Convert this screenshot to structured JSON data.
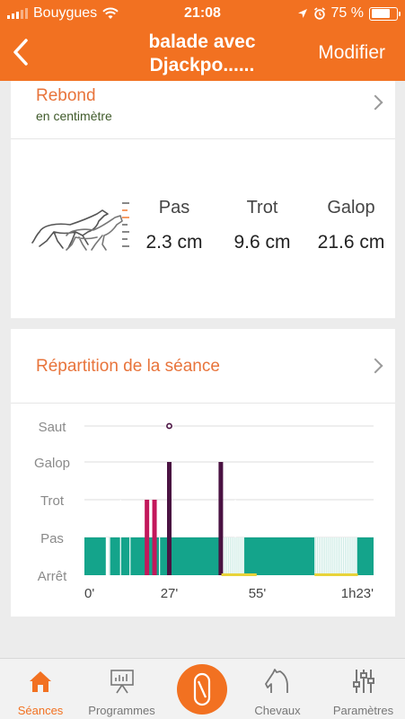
{
  "status": {
    "carrier": "Bouygues",
    "time": "21:08",
    "battery": "75 %",
    "battery_level": 0.75
  },
  "header": {
    "title_line1": "balade avec",
    "title_line2": "Djackpo......",
    "right_label": "Modifier"
  },
  "rebond": {
    "title": "Rebond",
    "subtitle": "en centimètre",
    "columns": [
      {
        "label": "Pas",
        "value": "2.3 cm"
      },
      {
        "label": "Trot",
        "value": "9.6 cm"
      },
      {
        "label": "Galop",
        "value": "21.6 cm"
      }
    ]
  },
  "repartition": {
    "title": "Répartition de la séance"
  },
  "chart_data": {
    "type": "bar",
    "categories": [
      "Arrêt",
      "Pas",
      "Trot",
      "Galop",
      "Saut"
    ],
    "x_tick_labels": [
      "0'",
      "27'",
      "55'",
      "1h23'"
    ],
    "x_ticks_minutes": [
      0,
      27,
      55,
      83
    ],
    "xlim": [
      0,
      92
    ],
    "grid": true,
    "events": [
      {
        "t": 8.0,
        "level": 1,
        "color": "#ffffff"
      },
      {
        "t": 11.5,
        "level": 2,
        "color": "#ffffff"
      },
      {
        "t": 14.5,
        "level": 1,
        "color": "#ffffff"
      },
      {
        "t": 19.9,
        "level": 2,
        "color": "#c2185b"
      },
      {
        "t": 22.3,
        "level": 2,
        "color": "#c2185b"
      },
      {
        "t": 23.9,
        "level": 1,
        "color": "#ffffff"
      },
      {
        "t": 27.0,
        "level": 3,
        "color": "#4a1242"
      },
      {
        "t": 43.4,
        "level": 3,
        "color": "#4a1242"
      },
      {
        "t": 44.3,
        "level": 1,
        "color": "#ffffff"
      },
      {
        "t": 46.5,
        "level": 1,
        "color": "#ffffff"
      },
      {
        "t": 47.5,
        "level": 1,
        "color": "#ffffff"
      },
      {
        "t": 48.0,
        "level": 2,
        "color": "#ffffff"
      },
      {
        "t": 48.7,
        "level": 1,
        "color": "#ffffff"
      },
      {
        "t": 50.2,
        "level": 1,
        "color": "#ffffff"
      },
      {
        "t": 75.0,
        "level": 1,
        "color": "#ffffff"
      },
      {
        "t": 77.0,
        "level": 1,
        "color": "#ffffff"
      },
      {
        "t": 79.5,
        "level": 1,
        "color": "#ffffff"
      },
      {
        "t": 82.3,
        "level": 1,
        "color": "#ffffff"
      },
      {
        "t": 86.6,
        "level": 1,
        "color": "#ffffff"
      }
    ],
    "white_gaps": [
      [
        6.8,
        7.8
      ],
      [
        44.3,
        50.8
      ],
      [
        73.2,
        86.6
      ]
    ],
    "jump_markers": [
      27.0
    ],
    "stop_segments": [
      [
        43.6,
        54.8
      ],
      [
        73.2,
        87.0
      ]
    ],
    "colors": {
      "walk": "#14a48b",
      "gait_canter": "#4a1242",
      "gait_trot": "#c2185b",
      "stop": "#e8d33a",
      "jump_marker": "#4a1242"
    }
  },
  "tabs": [
    {
      "label": "Séances",
      "icon": "home-icon",
      "active": true
    },
    {
      "label": "Programmes",
      "icon": "presentation-board-icon",
      "active": false
    },
    {
      "label": "",
      "icon": "record-session-icon",
      "active": false
    },
    {
      "label": "Chevaux",
      "icon": "horse-head-icon",
      "active": false
    },
    {
      "label": "Paramètres",
      "icon": "sliders-icon",
      "active": false
    }
  ],
  "theme": {
    "accent": "#f27121",
    "section_title": "#e8743b"
  }
}
